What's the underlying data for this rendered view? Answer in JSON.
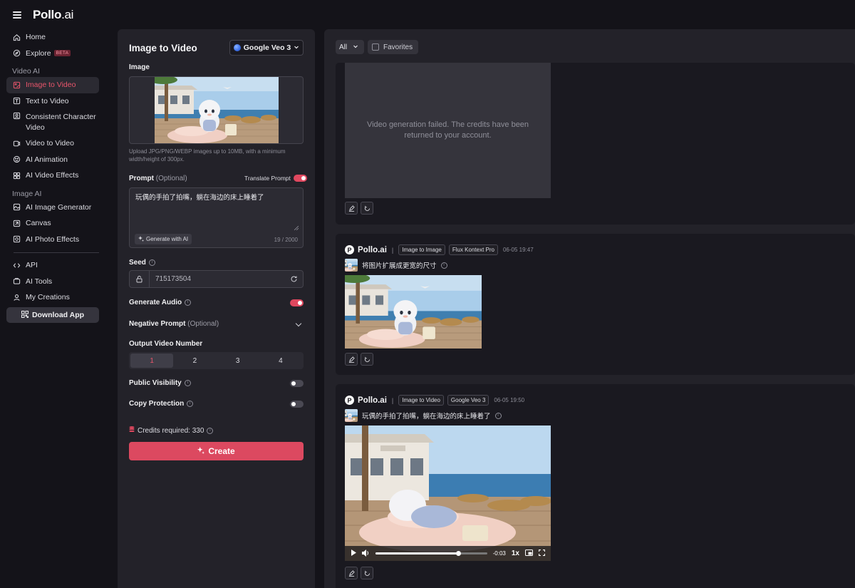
{
  "brand": {
    "name_bold": "Pollo",
    "name_suffix": ".ai"
  },
  "sidebar": {
    "home": "Home",
    "explore": "Explore",
    "explore_badge": "BETA",
    "section_video": "Video AI",
    "video_items": [
      "Image to Video",
      "Text to Video",
      "Consistent Character Video",
      "Video to Video",
      "AI Animation",
      "AI Video Effects"
    ],
    "section_image": "Image AI",
    "image_items": [
      "AI Image Generator",
      "Canvas",
      "AI Photo Effects"
    ],
    "other_items": [
      "API",
      "AI Tools",
      "My Creations"
    ],
    "download": "Download App",
    "active_item": "Image to Video"
  },
  "form": {
    "title": "Image to Video",
    "model": "Google Veo 3",
    "image_label": "Image",
    "upload_hint": "Upload JPG/PNG/WEBP images up to 10MB, with a minimum width/height of 300px.",
    "prompt_label": "Prompt",
    "prompt_optional": "(Optional)",
    "translate_label": "Translate Prompt",
    "translate_on": true,
    "prompt_value": "玩偶的手拍了拍嘴，躺在海边的床上睡着了",
    "generate_ai": "Generate with AI",
    "counter": "19 / 2000",
    "seed_label": "Seed",
    "seed_value": "715173504",
    "audio_label": "Generate Audio",
    "audio_on": true,
    "negative_label": "Negative Prompt",
    "negative_optional": "(Optional)",
    "output_label": "Output Video Number",
    "output_options": [
      "1",
      "2",
      "3",
      "4"
    ],
    "output_selected": "1",
    "public_label": "Public Visibility",
    "public_on": false,
    "copy_label": "Copy Protection",
    "copy_on": false,
    "credits": "Credits required: 330",
    "create": "Create"
  },
  "results": {
    "filter": "All",
    "favorites": "Favorites",
    "failed_message": "Video generation failed. The credits have been returned to your account.",
    "cards": [
      {
        "brand": "Pollo.ai",
        "tool": "Image to Image",
        "model": "Flux Kontext Pro",
        "time": "06-05 19:47",
        "prompt": "将图片扩展成更宽的尺寸"
      },
      {
        "brand": "Pollo.ai",
        "tool": "Image to Video",
        "model": "Google Veo 3",
        "time": "06-05 19:50",
        "prompt": "玩偶的手拍了拍嘴，躺在海边的床上睡着了",
        "video_time": "-0:03",
        "video_speed": "1x",
        "video_progress": 0.74
      }
    ]
  },
  "colors": {
    "accent": "#dc4960",
    "panel": "#232229",
    "bg": "#141319"
  }
}
